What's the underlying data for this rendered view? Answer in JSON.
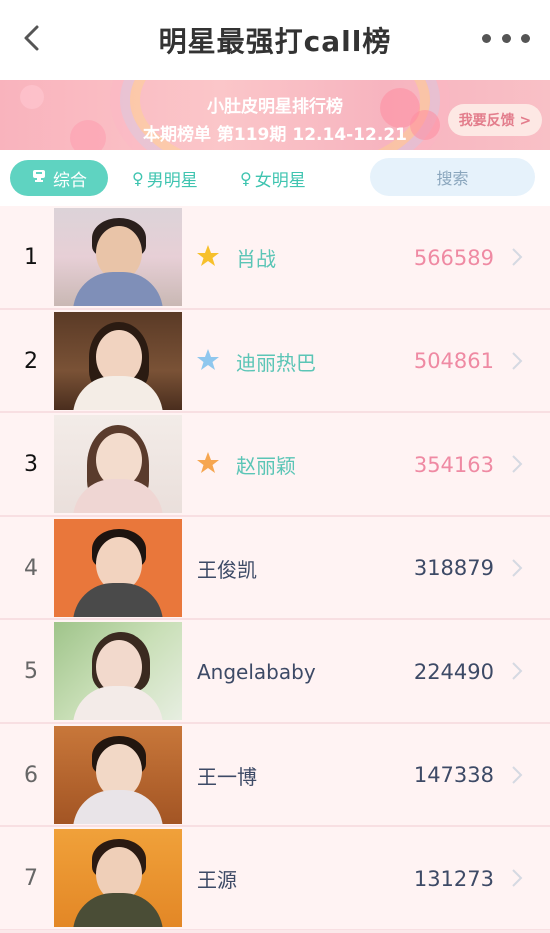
{
  "navbar": {
    "title": "明星最强打call榜",
    "back_icon": "back-chevron-icon",
    "more_icon": "more-dots-icon"
  },
  "banner": {
    "line1": "小肚皮明星排行榜",
    "line2_prefix": "本期榜单 第119期",
    "line2_period": "12.14-12.21",
    "feedback_label": "我要反馈 >"
  },
  "filters": {
    "all_label": "综合",
    "male_label": "男明星",
    "female_label": "女明星",
    "search_label": "搜索"
  },
  "colors": {
    "accent": "#5fd3c1",
    "score_top": "#ef8aa3",
    "text_dark": "#3d4a66",
    "star_gold": "#f7c02b",
    "star_blue": "#8fc7ee",
    "star_orange": "#f6a650"
  },
  "rows": [
    {
      "rank": "1",
      "name": "肖战",
      "score": "566589",
      "star": "gold"
    },
    {
      "rank": "2",
      "name": "迪丽热巴",
      "score": "504861",
      "star": "blue"
    },
    {
      "rank": "3",
      "name": "赵丽颖",
      "score": "354163",
      "star": "orange"
    },
    {
      "rank": "4",
      "name": "王俊凯",
      "score": "318879"
    },
    {
      "rank": "5",
      "name": "Angelababy",
      "score": "224490"
    },
    {
      "rank": "6",
      "name": "王一博",
      "score": "147338"
    },
    {
      "rank": "7",
      "name": "王源",
      "score": "131273"
    }
  ]
}
